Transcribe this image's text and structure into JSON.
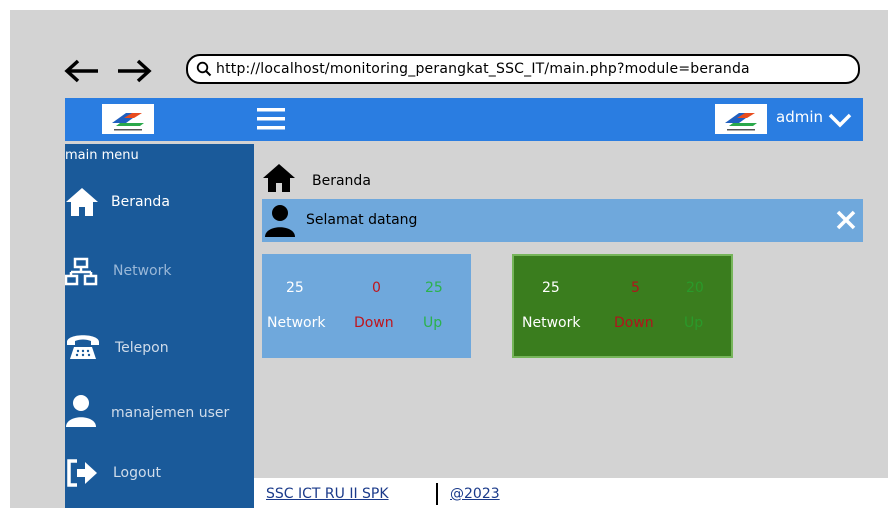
{
  "browser": {
    "back_icon": "arrow-left",
    "forward_icon": "arrow-right",
    "search_icon": "magnifier",
    "url": "http://localhost/monitoring_perangkat_SSC_IT/main.php?module=beranda"
  },
  "header": {
    "menu_icon": "hamburger",
    "user_name": "admin",
    "dropdown_icon": "chevron-down"
  },
  "sidebar": {
    "title": "main menu",
    "items": [
      {
        "label": "Beranda",
        "icon": "home-icon"
      },
      {
        "label": "Network",
        "icon": "network-icon"
      },
      {
        "label": "Telepon",
        "icon": "phone-icon"
      },
      {
        "label": "manajemen user",
        "icon": "user-icon"
      },
      {
        "label": "Logout",
        "icon": "logout-icon"
      }
    ]
  },
  "main": {
    "breadcrumb": "Beranda",
    "welcome": "Selamat datang",
    "cards": [
      {
        "total": "25",
        "down": "0",
        "up": "25",
        "total_label": "Network",
        "down_label": "Down",
        "up_label": "Up"
      },
      {
        "total": "25",
        "down": "5",
        "up": "20",
        "total_label": "Network",
        "down_label": "Down",
        "up_label": "Up"
      }
    ]
  },
  "footer": {
    "left": "SSC ICT RU II SPK",
    "right": "@2023"
  },
  "colors": {
    "topbar": "#2a7de1",
    "sidebar": "#1a5a9a",
    "welcome_bar": "#6fa8dc",
    "card_blue": "#6fa8dc",
    "card_green": "#3a7d1e",
    "down_red": "#c0141c",
    "up_green": "#2bb24c"
  }
}
